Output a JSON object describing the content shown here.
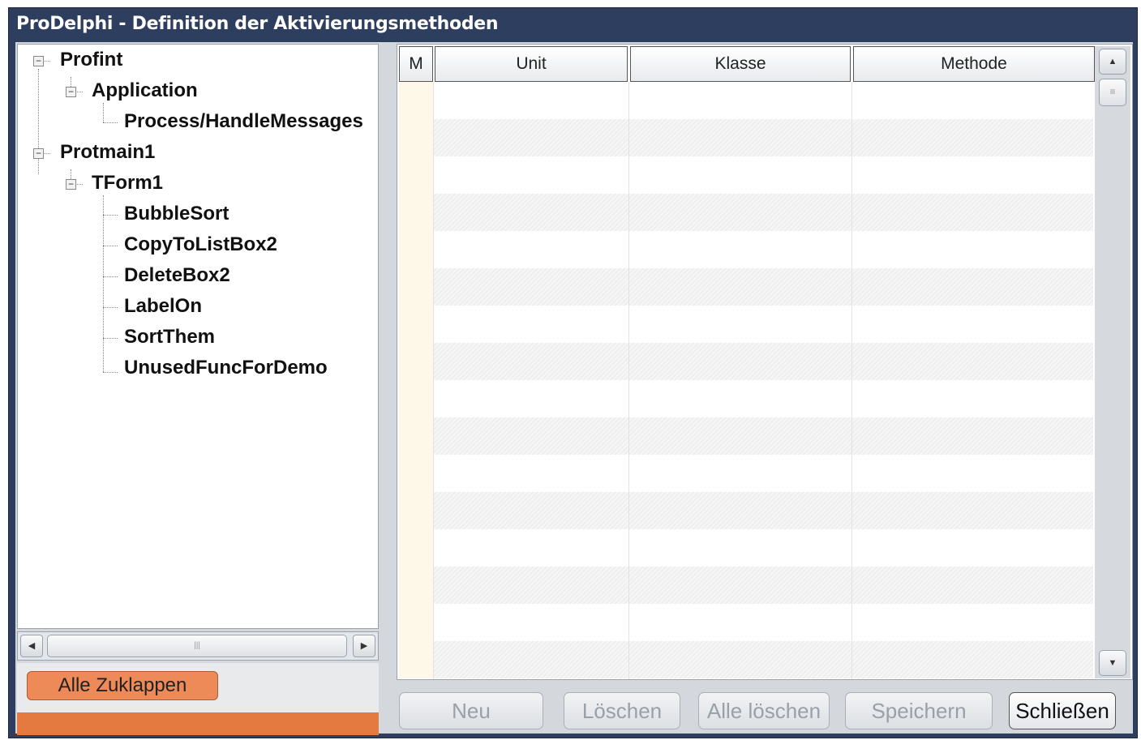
{
  "window": {
    "title": "ProDelphi - Definition der Aktivierungsmethoden"
  },
  "tree": {
    "profint": "Profint",
    "application": "Application",
    "process": "Process/HandleMessages",
    "protmain": "Protmain1",
    "tform": "TForm1",
    "bubblesort": "BubbleSort",
    "copy": "CopyToListBox2",
    "delete": "DeleteBox2",
    "labelon": "LabelOn",
    "sortthem": "SortThem",
    "unused": "UnusedFuncForDemo"
  },
  "left_panel": {
    "collapse_button": "Alle Zuklappen"
  },
  "grid": {
    "col_m": "M",
    "col_unit": "Unit",
    "col_klasse": "Klasse",
    "col_methode": "Methode"
  },
  "buttons": {
    "neu": "Neu",
    "loeschen": "Löschen",
    "alle_loeschen": "Alle löschen",
    "speichern": "Speichern",
    "schliessen": "Schließen"
  },
  "icons": {
    "expander": "minus-box-icon",
    "scroll_left": "arrow-left-icon",
    "scroll_right": "arrow-right-icon",
    "scroll_up": "arrow-up-icon",
    "scroll_down": "arrow-down-icon"
  },
  "colors": {
    "title_bar": "#2e3e5e",
    "accent_orange": "#e57a40",
    "button_orange": "#ee8a58"
  }
}
